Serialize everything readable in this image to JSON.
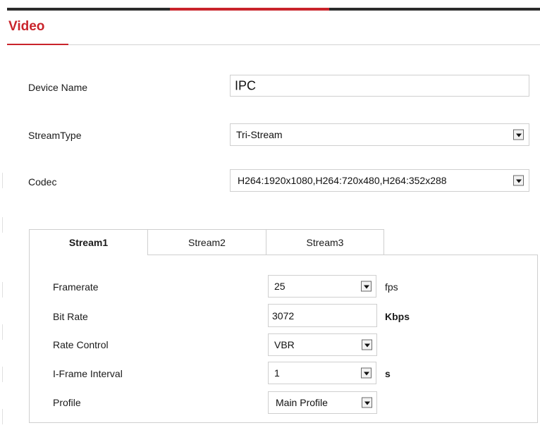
{
  "header": {
    "title": "Video"
  },
  "device": {
    "label": "Device Name",
    "value": "IPC"
  },
  "stream_type": {
    "label": "StreamType",
    "value": "Tri-Stream"
  },
  "codec": {
    "label": "Codec",
    "value": "H264:1920x1080,H264:720x480,H264:352x288"
  },
  "tabs": [
    {
      "label": "Stream1",
      "active": true
    },
    {
      "label": "Stream2",
      "active": false
    },
    {
      "label": "Stream3",
      "active": false
    }
  ],
  "stream": {
    "framerate": {
      "label": "Framerate",
      "value": "25",
      "unit": "fps"
    },
    "bitrate": {
      "label": "Bit Rate",
      "value": "3072",
      "unit": "Kbps"
    },
    "rate_control": {
      "label": "Rate Control",
      "value": "VBR"
    },
    "iframe": {
      "label": "I-Frame Interval",
      "value": "1",
      "unit": "s"
    },
    "profile": {
      "label": "Profile",
      "value": "Main Profile"
    }
  },
  "colors": {
    "accent": "#c9242b",
    "dark_bar": "#2b2b2b"
  }
}
